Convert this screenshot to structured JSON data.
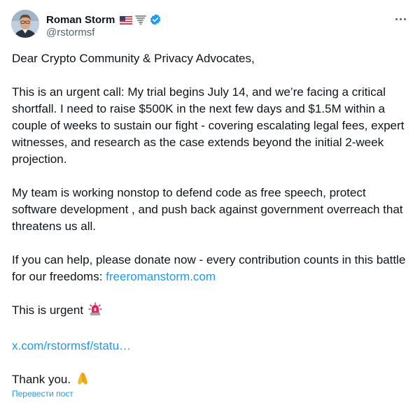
{
  "author": {
    "name": "Roman Storm",
    "handle": "@rstormsf",
    "badges": [
      "us-flag-icon",
      "tornado-icon",
      "verified-badge-icon"
    ]
  },
  "post": {
    "greeting": "Dear Crypto Community & Privacy Advocates,",
    "para1": "This is an urgent call: My trial begins July 14, and we’re facing a critical shortfall. I need to raise $500K in the next few days and $1.5M within a couple of weeks to sustain our fight - covering escalating legal fees, expert witnesses, and research as the case extends beyond the initial 2-week projection.",
    "para2": "My team is working nonstop to defend code as free speech, protect software development , and push back against government overreach that threatens us all.",
    "para3_text": "If you can help, please donate now - every contribution counts in this battle for our freedoms: ",
    "para3_link": "freeromanstorm.com",
    "urgent_text": "This is urgent",
    "status_link": "x.com/rstormsf/statu…",
    "thanks_text": "Thank you."
  },
  "translate_label": "Перевести пост",
  "colors": {
    "link": "#1d9bf0",
    "text": "#0f1419",
    "muted": "#536471"
  }
}
